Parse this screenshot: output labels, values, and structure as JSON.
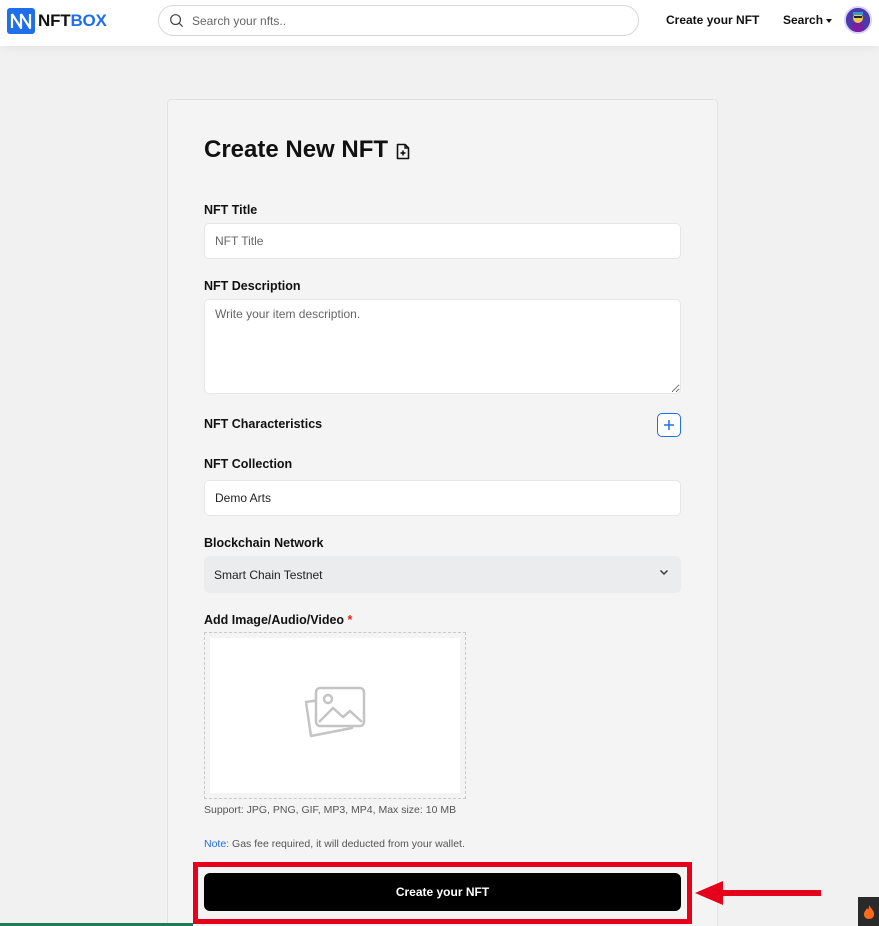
{
  "header": {
    "logo_text_1": "NFT",
    "logo_text_2": "BOX",
    "search_placeholder": "Search your nfts..",
    "nav_create": "Create your NFT",
    "nav_search": "Search"
  },
  "form": {
    "title": "Create New NFT",
    "nft_title_label": "NFT Title",
    "nft_title_placeholder": "NFT Title",
    "nft_description_label": "NFT Description",
    "nft_description_placeholder": "Write your item description.",
    "characteristics_label": "NFT Characteristics",
    "collection_label": "NFT Collection",
    "collection_value": "Demo Arts",
    "blockchain_label": "Blockchain Network",
    "blockchain_value": "Smart Chain Testnet",
    "media_label": "Add Image/Audio/Video",
    "media_required": "*",
    "support_hint": "Support: JPG, PNG, GIF, MP3, MP4, Max size: 10 MB",
    "note_prefix": "Note:",
    "note_text": " Gas fee required, it will deducted from your wallet.",
    "submit_label": "Create your NFT"
  },
  "colors": {
    "accent": "#1f6feb",
    "highlight": "#e5001b",
    "submit_bg": "#000000"
  },
  "icons": {
    "search": "search-icon",
    "file_add": "file-plus-icon",
    "plus": "plus-icon",
    "chevron": "chevron-down-icon",
    "image_placeholder": "image-icon",
    "arrow": "arrow-left-icon"
  }
}
